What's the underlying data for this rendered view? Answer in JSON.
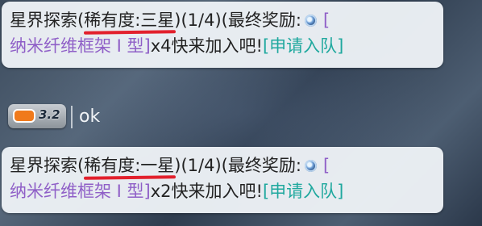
{
  "messages": [
    {
      "prefix": "星界探索(",
      "rarity": "稀有度:三星",
      "progress": ")(1/4)(最终奖励:",
      "bracket_open": "[",
      "item": "纳米纤维框架 I 型]",
      "qty": "x4快来加入吧!",
      "join": "[申请入队]"
    },
    {
      "badge_value": "3.2",
      "text": "ok"
    },
    {
      "prefix": "星界探索(",
      "rarity": "稀有度:一星",
      "progress": ")(1/4)(最终奖励:",
      "bracket_open": "[",
      "item": "纳米纤维框架 I 型]",
      "qty": "x2快来加入吧!",
      "join": "[申请入队]"
    }
  ],
  "icons": {
    "reward": "gem-icon",
    "level": "level-icon"
  },
  "colors": {
    "item": "#8f5fc7",
    "join": "#1fa89e",
    "underline": "#e2202c"
  }
}
